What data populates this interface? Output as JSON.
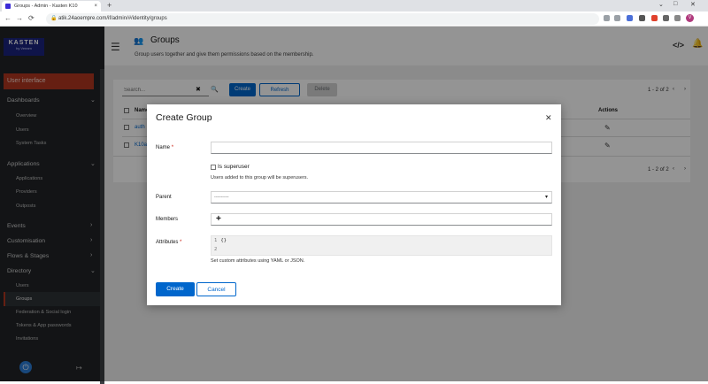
{
  "browser": {
    "tab_title": "Groups - Admin - Kasten K10",
    "tab_close": "×",
    "new_tab": "+",
    "url": "atik.24aoempre.com/if/admin/#/identity/groups",
    "window_minimize": "⌄",
    "window_maximize": "□",
    "window_close": "✕",
    "profile_initial": "V",
    "nav_back": "←",
    "nav_forward": "→",
    "nav_reload": "⟳",
    "lock": "🔒"
  },
  "sidebar": {
    "logo_main": "KASTEN",
    "logo_sub": "by Veeam",
    "user_interface": "User interface",
    "chevron": "›",
    "chevron_open": "⌄",
    "sections": {
      "dashboards": "Dashboards",
      "applications": "Applications",
      "events": "Events",
      "customisation": "Customisation",
      "flows": "Flows & Stages",
      "directory": "Directory"
    },
    "dashboards_items": [
      "Overview",
      "Users",
      "System Tasks"
    ],
    "applications_items": [
      "Applications",
      "Providers",
      "Outposts"
    ],
    "directory_items": [
      "Users",
      "Groups",
      "Federation & Social login",
      "Tokens & App passwords",
      "Invitations"
    ],
    "power_icon": "⏻",
    "logout_icon": "↦"
  },
  "header": {
    "hamburger": "☰",
    "page_icon": "👥",
    "title": "Groups",
    "description": "Group users together and give them permissions based on the membership.",
    "code_icon": "</>",
    "bell_icon": "🔔"
  },
  "toolbar": {
    "search_placeholder": "Search...",
    "clear_icon": "✖",
    "search_icon": "🔍",
    "create": "Create",
    "refresh": "Refresh",
    "delete": "Delete",
    "pager_text": "1 - 2 of 2",
    "prev": "‹",
    "next": "›"
  },
  "table": {
    "name_header": "Name",
    "actions_header": "Actions",
    "rows": [
      {
        "name": "auth"
      },
      {
        "name": "K10a"
      }
    ],
    "edit_icon": "✎"
  },
  "modal": {
    "title": "Create Group",
    "close_icon": "✕",
    "name_label": "Name",
    "required_mark": "*",
    "superuser_label": "Is superuser",
    "superuser_help": "Users added to this group will be superusers.",
    "parent_label": "Parent",
    "parent_value": "---------",
    "caret": "▾",
    "members_label": "Members",
    "members_add": "+",
    "attributes_label": "Attributes",
    "attributes_lines": [
      {
        "num": "1",
        "text": "{}"
      },
      {
        "num": "2",
        "text": ""
      }
    ],
    "attributes_help": "Set custom attributes using YAML or JSON.",
    "create": "Create",
    "cancel": "Cancel"
  },
  "colors": {
    "primary": "#0066cc",
    "accent": "#b0361f",
    "sidebar_bg": "#212427"
  }
}
